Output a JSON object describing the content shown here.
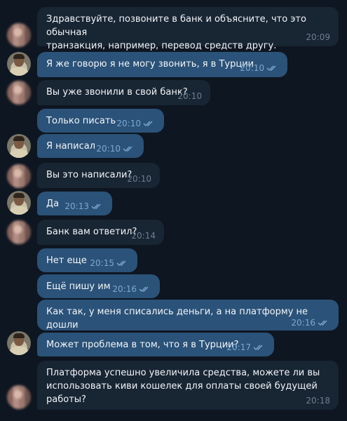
{
  "messages": [
    {
      "text": "Здравствуйте, позвоните в банк и объясните, что это обычная\nтранзакция, например, перевод средств другу.",
      "time": "20:09",
      "dir": "in"
    },
    {
      "text": "Я же говорю я не могу звонить, я в Турции",
      "time": "20:10",
      "dir": "out"
    },
    {
      "text": "Вы уже звонили в свой банк?",
      "time": "20:10",
      "dir": "in"
    },
    {
      "text": "Только писать",
      "time": "20:10",
      "dir": "out"
    },
    {
      "text": "Я написал",
      "time": "20:10",
      "dir": "out"
    },
    {
      "text": "Вы это написали?",
      "time": "20:10",
      "dir": "in"
    },
    {
      "text": "Да",
      "time": "20:13",
      "dir": "out"
    },
    {
      "text": "Банк вам ответил?",
      "time": "20:14",
      "dir": "in"
    },
    {
      "text": "Нет еще",
      "time": "20:15",
      "dir": "out"
    },
    {
      "text": "Ещё пишу им",
      "time": "20:16",
      "dir": "out"
    },
    {
      "text": "Как так, у меня списались деньги, а на платформу не дошли",
      "time": "20:16",
      "dir": "out"
    },
    {
      "text": "Может проблема в том, что я в Турции?",
      "time": "20:17",
      "dir": "out"
    },
    {
      "text": "Платформа успешно увеличила средства, можете ли вы\nиспользовать киви кошелек для оплаты своей будущей\nработы?",
      "time": "20:18",
      "dir": "in"
    }
  ],
  "read_receipt_icon": "double-check-icon",
  "colors": {
    "background": "#0e1621",
    "incoming_bubble": "#182533",
    "outgoing_bubble": "#2b5278",
    "text": "#f2f5f8",
    "time_incoming": "#6d7f8f",
    "time_outgoing": "#7da8d3"
  }
}
